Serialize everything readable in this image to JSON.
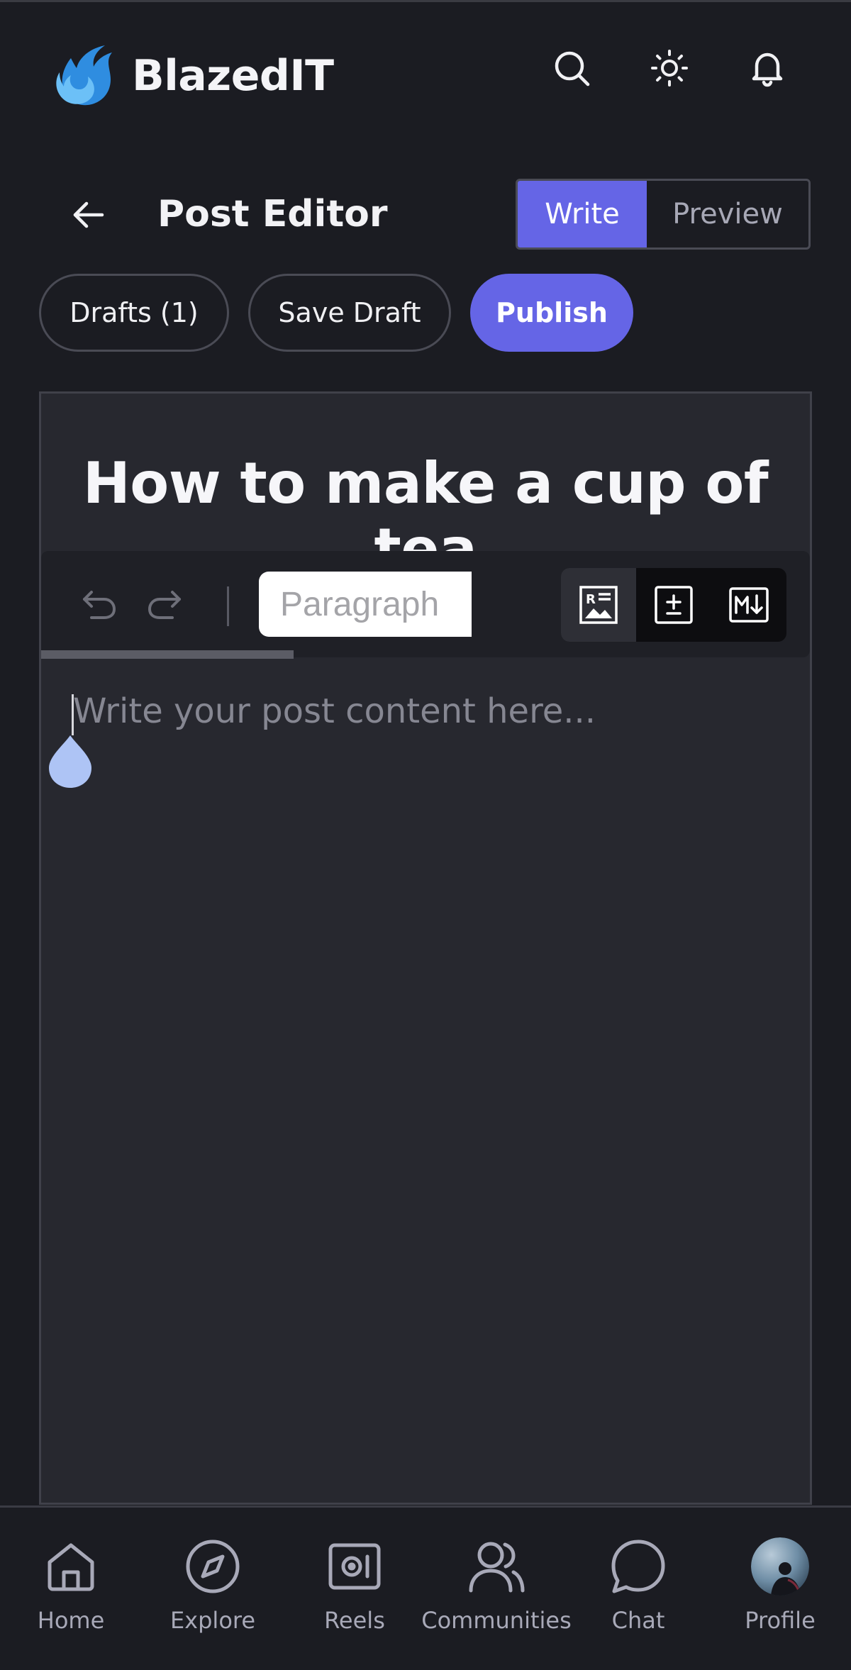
{
  "app": {
    "name": "BlazedIT"
  },
  "header": {
    "icons": [
      "search-icon",
      "sun-icon",
      "bell-icon"
    ]
  },
  "editor_bar": {
    "title": "Post Editor",
    "tabs": [
      {
        "label": "Write",
        "active": true
      },
      {
        "label": "Preview",
        "active": false
      }
    ]
  },
  "actions": {
    "drafts_label": "Drafts (1)",
    "save_label": "Save Draft",
    "publish_label": "Publish"
  },
  "post": {
    "title": "How to make a cup of tea",
    "body_placeholder": "Write your post content here..."
  },
  "toolbar": {
    "block_type": "Paragraph",
    "buttons": [
      "undo-icon",
      "redo-icon",
      "image-caption-icon",
      "math-icon",
      "markdown-icon"
    ]
  },
  "bottom_nav": {
    "items": [
      {
        "label": "Home",
        "icon": "home-icon"
      },
      {
        "label": "Explore",
        "icon": "compass-icon"
      },
      {
        "label": "Reels",
        "icon": "reels-icon"
      },
      {
        "label": "Communities",
        "icon": "users-icon"
      },
      {
        "label": "Chat",
        "icon": "chat-icon"
      },
      {
        "label": "Profile",
        "icon": "avatar"
      }
    ]
  },
  "colors": {
    "background": "#1b1c22",
    "accent": "#6565e6",
    "editor_bg": "#27282f",
    "logo_blue": "#4aa8f0"
  }
}
